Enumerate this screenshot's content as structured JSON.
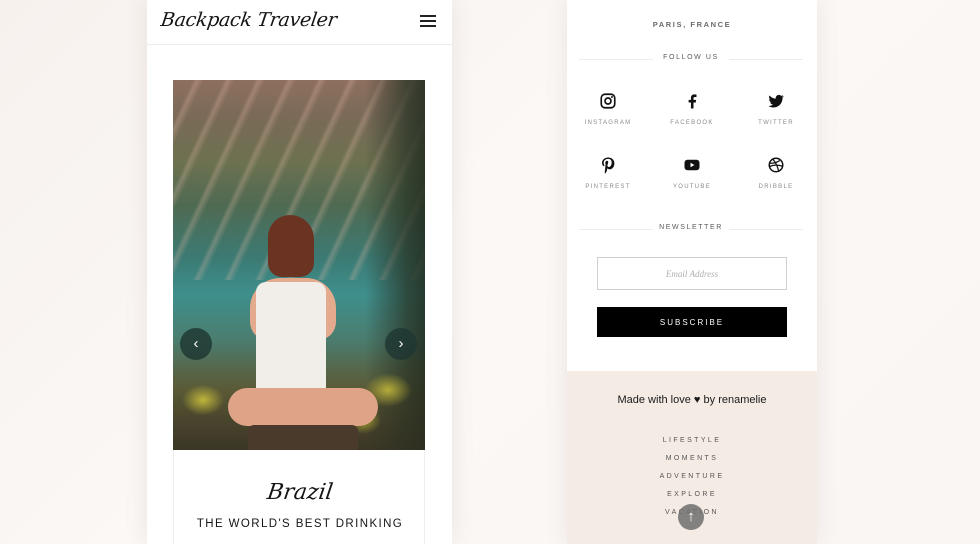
{
  "left_phone": {
    "logo": "Backpack Traveler",
    "menu_icon": "hamburger-menu-icon",
    "slider": {
      "prev_icon": "chevron-left-icon",
      "next_icon": "chevron-right-icon",
      "prev_glyph": "‹",
      "next_glyph": "›"
    },
    "card": {
      "script_title": "Brazil",
      "title": "THE WORLD'S BEST DRINKING"
    }
  },
  "right_phone": {
    "location": "PARIS, FRANCE",
    "follow_heading": "FOLLOW US",
    "social": [
      {
        "label": "INSTAGRAM",
        "icon": "instagram-icon"
      },
      {
        "label": "FACEBOOK",
        "icon": "facebook-icon"
      },
      {
        "label": "TWITTER",
        "icon": "twitter-icon"
      },
      {
        "label": "PINTEREST",
        "icon": "pinterest-icon"
      },
      {
        "label": "YOUTUBE",
        "icon": "youtube-icon"
      },
      {
        "label": "DRIBBLE",
        "icon": "dribbble-icon"
      }
    ],
    "newsletter_heading": "NEWSLETTER",
    "email_placeholder": "Email Address",
    "subscribe_label": "SUBSCRIBE",
    "footer": {
      "made_with_prefix": "Made with love",
      "made_with_suffix": "by renamelie",
      "heart_glyph": "♥",
      "links": [
        "LIFESTYLE",
        "MOMENTS",
        "ADVENTURE",
        "EXPLORE",
        "VACATION"
      ],
      "scroll_top_icon": "arrow-up-icon",
      "scroll_top_glyph": "↑"
    }
  },
  "colors": {
    "background": "#f8f3f0",
    "footer_bg": "#f4ebe5",
    "text_dark": "#151515",
    "button_bg": "#000000"
  }
}
